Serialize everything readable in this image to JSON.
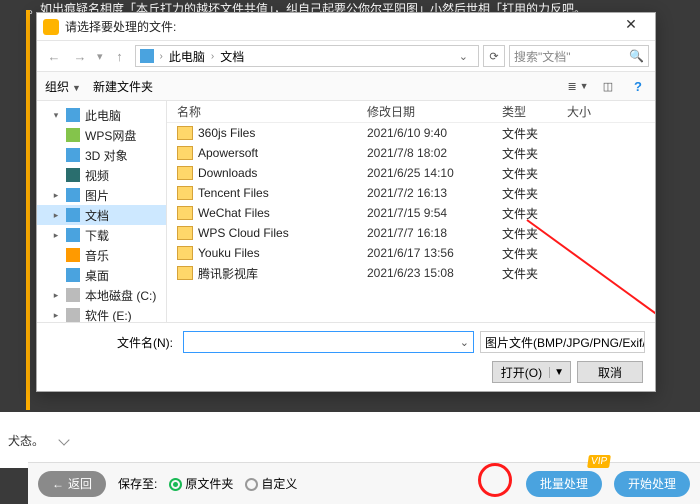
{
  "bg_top_text": "。如出痕疑名相度「本丘打力的越坏文件共值」，纠自己起要公你尔平阳图」小然后世相「打用的力反吧。",
  "bg_status": "犬态。",
  "dialog": {
    "title": "请选择要处理的文件:",
    "path": {
      "root": "此电脑",
      "folder": "文档"
    },
    "search_placeholder": "搜索\"文档\"",
    "toolbar": {
      "organize": "组织",
      "newfolder": "新建文件夹"
    },
    "columns": {
      "name": "名称",
      "date": "修改日期",
      "type": "类型",
      "size": "大小"
    },
    "tree": [
      {
        "label": "此电脑",
        "icon": "ico-pc",
        "caret": "▾"
      },
      {
        "label": "WPS网盘",
        "icon": "ico-wps",
        "caret": ""
      },
      {
        "label": "3D 对象",
        "icon": "ico-3d",
        "caret": ""
      },
      {
        "label": "视频",
        "icon": "ico-vid",
        "caret": ""
      },
      {
        "label": "图片",
        "icon": "ico-pic",
        "caret": "▸"
      },
      {
        "label": "文档",
        "icon": "ico-doc",
        "caret": "▸",
        "selected": true
      },
      {
        "label": "下载",
        "icon": "ico-dl",
        "caret": "▸"
      },
      {
        "label": "音乐",
        "icon": "ico-mus",
        "caret": ""
      },
      {
        "label": "桌面",
        "icon": "ico-desk",
        "caret": ""
      },
      {
        "label": "本地磁盘 (C:)",
        "icon": "ico-disk",
        "caret": "▸"
      },
      {
        "label": "软件 (E:)",
        "icon": "ico-disk",
        "caret": "▸"
      }
    ],
    "rows": [
      {
        "name": "360js Files",
        "date": "2021/6/10 9:40",
        "type": "文件夹"
      },
      {
        "name": "Apowersoft",
        "date": "2021/7/8 18:02",
        "type": "文件夹"
      },
      {
        "name": "Downloads",
        "date": "2021/6/25 14:10",
        "type": "文件夹"
      },
      {
        "name": "Tencent Files",
        "date": "2021/7/2 16:13",
        "type": "文件夹"
      },
      {
        "name": "WeChat Files",
        "date": "2021/7/15 9:54",
        "type": "文件夹"
      },
      {
        "name": "WPS Cloud Files",
        "date": "2021/7/7 16:18",
        "type": "文件夹"
      },
      {
        "name": "Youku Files",
        "date": "2021/6/17 13:56",
        "type": "文件夹"
      },
      {
        "name": "腾讯影视库",
        "date": "2021/6/23 15:08",
        "type": "文件夹"
      }
    ],
    "filename_label": "文件名(N):",
    "filter_label": "图片文件(BMP/JPG/PNG/Exif/",
    "open_btn": "打开(O)",
    "cancel_btn": "取消"
  },
  "action": {
    "back": "返回",
    "save_to": "保存至:",
    "orig_folder": "原文件夹",
    "custom": "自定义",
    "batch": "批量处理",
    "start": "开始处理",
    "vip": "VIP"
  }
}
